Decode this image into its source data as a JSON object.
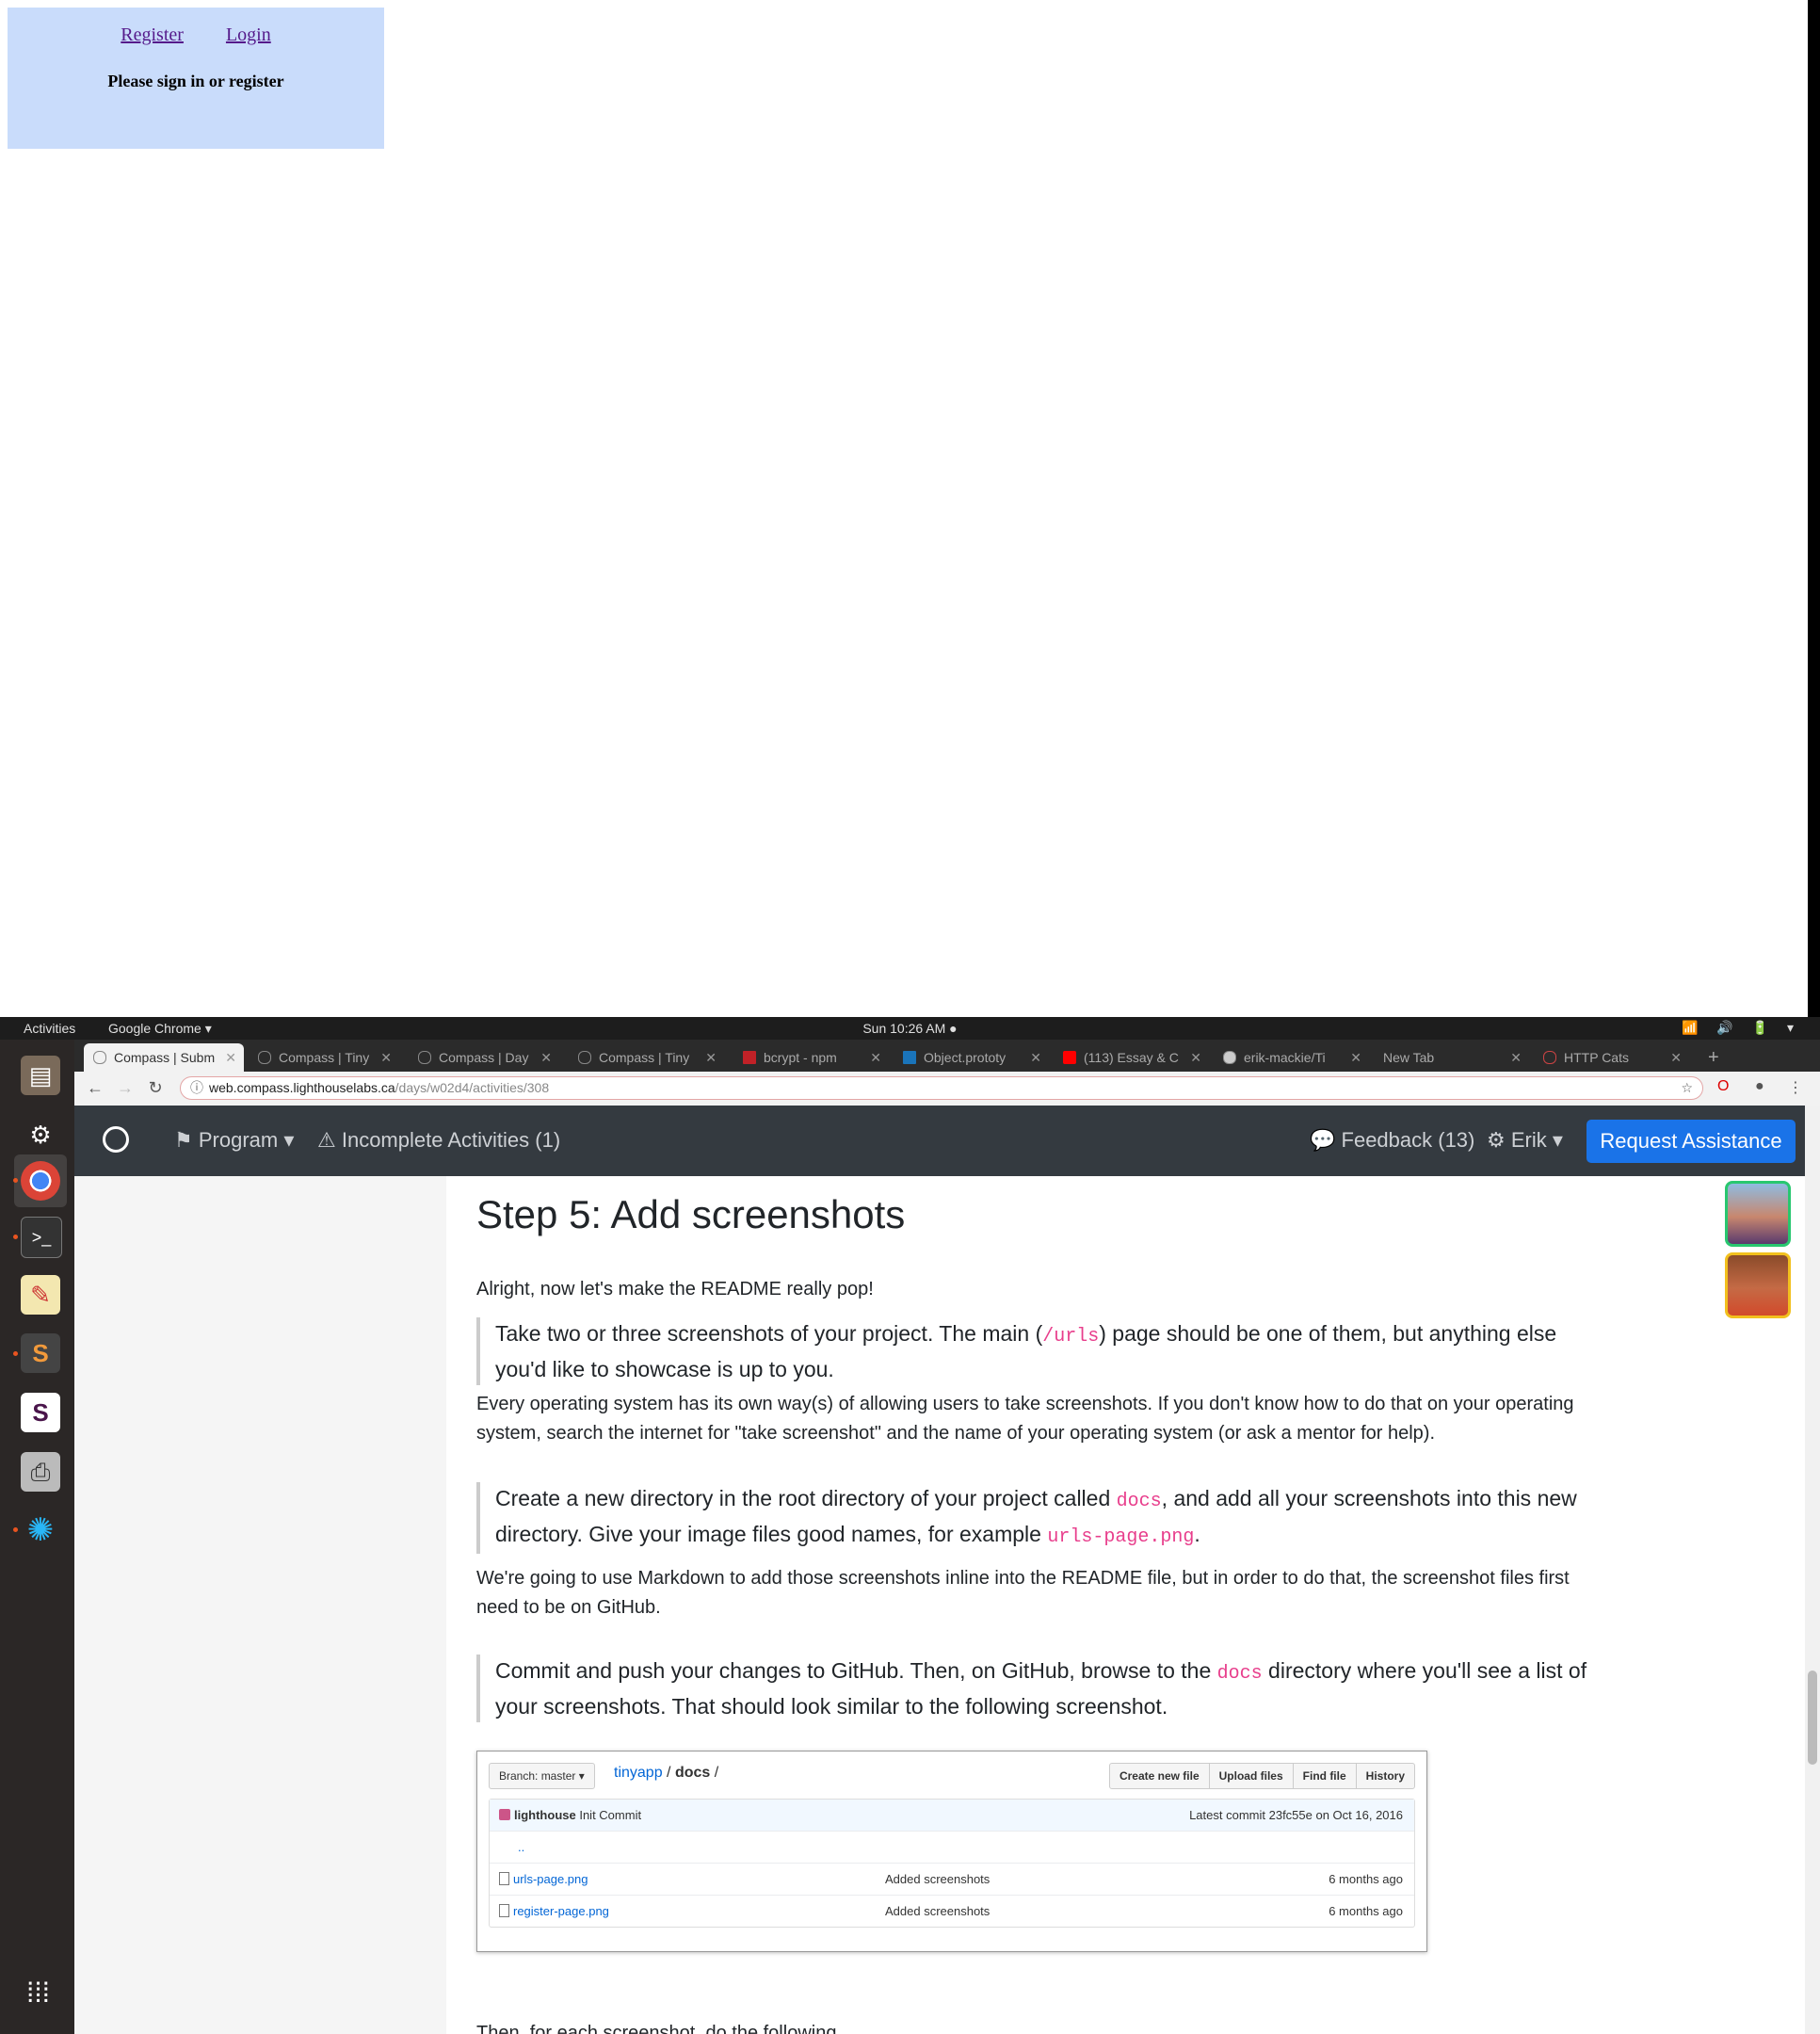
{
  "webapp": {
    "nav": {
      "register": "Register",
      "login": "Login"
    },
    "message": "Please sign in or register"
  },
  "desktop": {
    "topbar": {
      "activities": "Activities",
      "app_name": "Google Chrome ▾",
      "clock": "Sun 10:26 AM ●",
      "system_icons": "📶 🔊 🔋 ▾"
    },
    "tabs": [
      {
        "label": "Compass | Subm"
      },
      {
        "label": "Compass | Tiny"
      },
      {
        "label": "Compass | Day"
      },
      {
        "label": "Compass | Tiny"
      },
      {
        "label": "bcrypt - npm"
      },
      {
        "label": "Object.prototy"
      },
      {
        "label": "(113) Essay & C"
      },
      {
        "label": "erik-mackie/Ti"
      },
      {
        "label": "New Tab"
      },
      {
        "label": "HTTP Cats"
      }
    ],
    "url": {
      "host": "web.compass.lighthouselabs.ca",
      "path": "/days/w02d4/activities/308"
    },
    "site_nav": {
      "program": "Program ▾",
      "incomplete": "Incomplete Activities (1)",
      "feedback": "Feedback (13)",
      "user": "Erik ▾",
      "request": "Request Assistance"
    },
    "content": {
      "heading": "Step 5: Add screenshots",
      "intro": "Alright, now let's make the README really pop!",
      "bq1_before": "Take two or three screenshots of your project. The main (",
      "bq1_code": "/urls",
      "bq1_after": ") page should be one of them, but anything else you'd like to showcase is up to you.",
      "p2": "Every operating system has its own way(s) of allowing users to take screenshots. If you don't know how to do that on your operating system, search the internet for \"take screenshot\" and the name of your operating system (or ask a mentor for help).",
      "bq2_before": "Create a new directory in the root directory of your project called ",
      "bq2_code1": "docs",
      "bq2_mid": ", and add all your screenshots into this new directory. Give your image files good names, for example ",
      "bq2_code2": "urls-page.png",
      "bq2_after": ".",
      "p3": "We're going to use Markdown to add those screenshots inline into the README file, but in order to do that, the screenshot files first need to be on GitHub.",
      "bq3_before": "Commit and push your changes to GitHub. Then, on GitHub, browse to the ",
      "bq3_code": "docs",
      "bq3_after": " directory where you'll see a list of your screenshots. That should look similar to the following screenshot.",
      "cutoff": "Then, for each screenshot, do the following"
    },
    "github": {
      "branch": "Branch: master ▾",
      "repo": "tinyapp",
      "sep1": " / ",
      "folder": "docs",
      "sep2": " /",
      "buttons": [
        "Create new file",
        "Upload files",
        "Find file",
        "History"
      ],
      "commit_user": "lighthouse",
      "commit_msg": "Init Commit",
      "latest": "Latest commit 23fc55e on Oct 16, 2016",
      "parent": "..",
      "files": [
        {
          "name": "urls-page.png",
          "msg": "Added screenshots",
          "age": "6 months ago"
        },
        {
          "name": "register-page.png",
          "msg": "Added screenshots",
          "age": "6 months ago"
        }
      ]
    }
  }
}
